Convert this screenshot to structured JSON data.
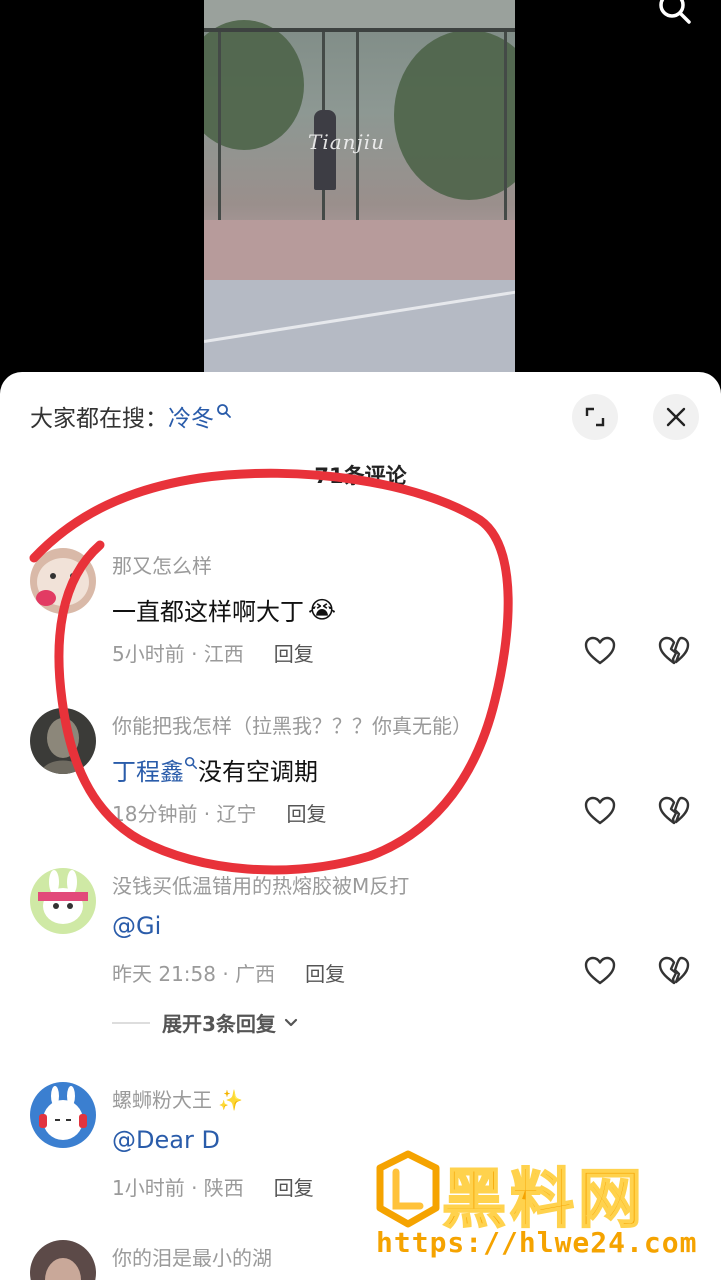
{
  "video": {
    "watermark_text": "Tianjiu"
  },
  "header": {
    "search_prefix": "大家都在搜：",
    "search_term": "冷冬",
    "comment_count": "71条评论"
  },
  "comments": [
    {
      "nick": "那又怎么样",
      "content": "一直都这样啊大丁",
      "emoji": "😭",
      "time": "5小时前 · 江西",
      "reply": "回复"
    },
    {
      "nick": "你能把我怎样（拉黑我？？？你真无能）",
      "mention": "丁程鑫",
      "content": "没有空调期",
      "time": "18分钟前 · 辽宁",
      "reply": "回复"
    },
    {
      "nick": "没钱买低温错用的热熔胶被M反打",
      "mention": "@Gi",
      "time": "昨天 21:58 · 广西",
      "reply": "回复",
      "expand": "展开3条回复"
    },
    {
      "nick": "螺蛳粉大王",
      "nick_emoji": "✨",
      "mention": "@Dear D",
      "time": "1小时前 · 陕西",
      "reply": "回复"
    },
    {
      "nick": "你的泪是最小的湖"
    }
  ],
  "site": {
    "name": "黑料网",
    "url": "https://hlwe24.com"
  },
  "colors": {
    "mention": "#2a5caa",
    "annotation": "#e8323a",
    "brand": "#f5a300"
  }
}
